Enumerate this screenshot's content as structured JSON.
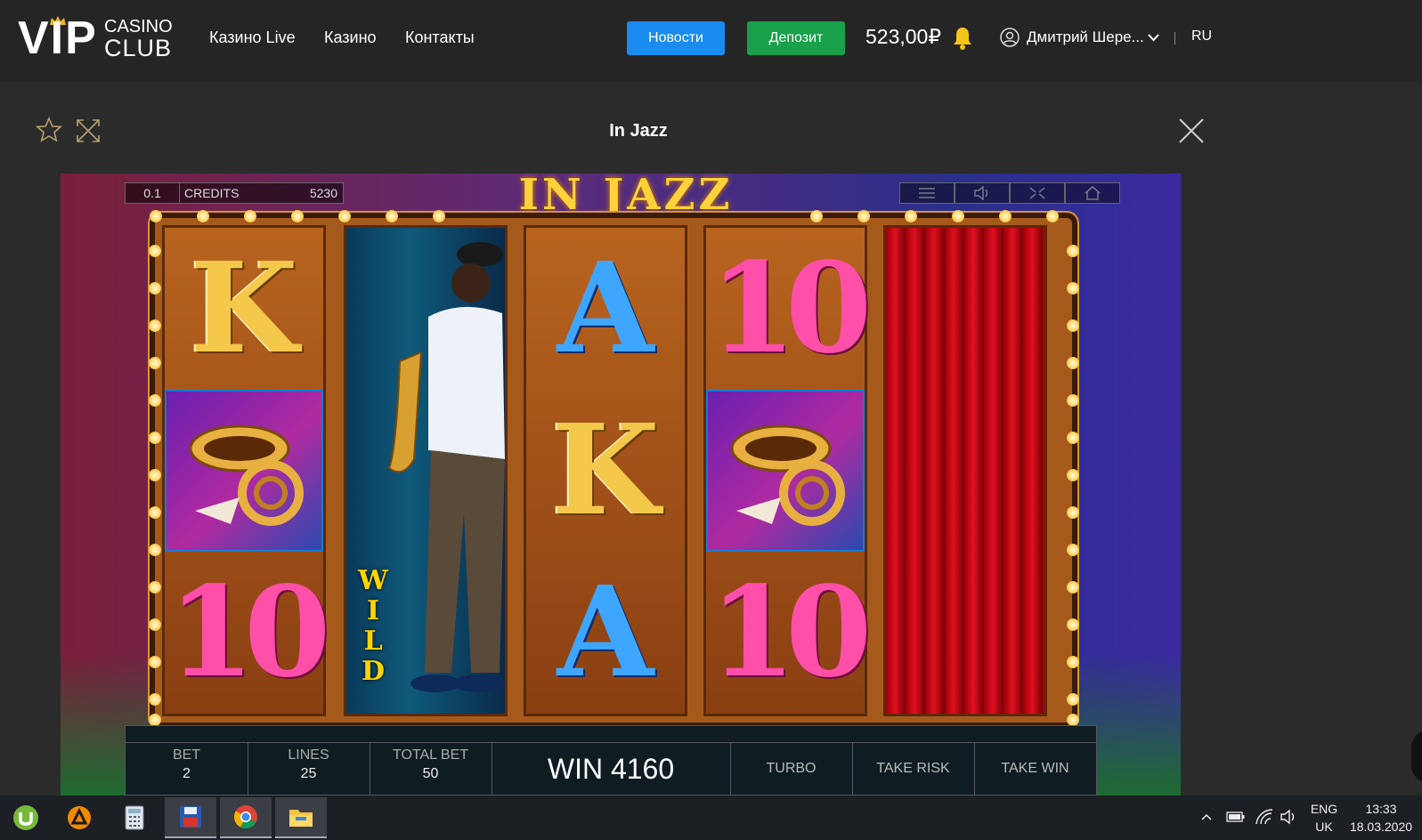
{
  "header": {
    "logo": {
      "vip": "VIP",
      "casino": "CASINO",
      "club": "CLUB"
    },
    "nav": [
      "Казино Live",
      "Казино",
      "Контакты"
    ],
    "news_button": "Новости",
    "deposit_button": "Депозит",
    "balance": "523,00₽",
    "user_name": "Дмитрий Шере...",
    "language": "RU"
  },
  "game": {
    "title": "In Jazz",
    "slot_title": "IN JAZZ",
    "denomination": "0.1",
    "credits_label": "CREDITS",
    "credits_value": "5230",
    "reels": [
      [
        "K",
        "horn",
        "10"
      ],
      [
        "wild-saxophonist"
      ],
      [
        "A",
        "K",
        "A"
      ],
      [
        "10",
        "horn",
        "10"
      ],
      [
        "curtain"
      ]
    ],
    "wild_label": "WILD",
    "panel": {
      "bet_label": "BET",
      "bet_value": "2",
      "lines_label": "LINES",
      "lines_value": "25",
      "total_bet_label": "TOTAL BET",
      "total_bet_value": "50",
      "win": "WIN 4160",
      "turbo": "TURBO",
      "take_risk": "TAKE RISK",
      "take_win": "TAKE WIN"
    }
  },
  "taskbar": {
    "apps": [
      "utorrent-icon",
      "avast-icon",
      "calculator-icon",
      "save-icon",
      "chrome-icon",
      "explorer-icon"
    ],
    "language_top": "ENG",
    "language_bottom": "UK",
    "time": "13:33",
    "date": "18.03.2020"
  },
  "colors": {
    "news": "#1a8cf0",
    "deposit": "#19a04a",
    "bell": "#f5c518"
  }
}
